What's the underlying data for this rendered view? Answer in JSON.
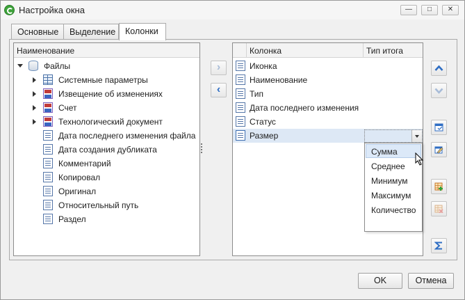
{
  "window": {
    "title": "Настройка окна",
    "controls": {
      "minimize": "—",
      "maximize": "□",
      "close": "✕"
    }
  },
  "tabs": [
    {
      "label": "Основные",
      "active": false
    },
    {
      "label": "Выделение",
      "active": false
    },
    {
      "label": "Колонки",
      "active": true
    }
  ],
  "available_fields": {
    "header": "Наименование",
    "items": [
      {
        "label": "Файлы",
        "icon": "database-icon",
        "expander": "expanded"
      },
      {
        "label": "Системные параметры",
        "icon": "table-icon",
        "expander": "collapsed"
      },
      {
        "label": "Извещение об изменениях",
        "icon": "reference-icon",
        "expander": "collapsed"
      },
      {
        "label": "Счет",
        "icon": "reference-icon",
        "expander": "collapsed"
      },
      {
        "label": "Технологический документ",
        "icon": "reference-icon",
        "expander": "collapsed"
      },
      {
        "label": "Дата последнего изменения файла",
        "icon": "field-icon"
      },
      {
        "label": "Дата создания дубликата",
        "icon": "field-icon"
      },
      {
        "label": "Комментарий",
        "icon": "field-icon"
      },
      {
        "label": "Копировал",
        "icon": "field-icon"
      },
      {
        "label": "Оригинал",
        "icon": "field-icon"
      },
      {
        "label": "Относительный путь",
        "icon": "field-icon"
      },
      {
        "label": "Раздел",
        "icon": "field-icon"
      }
    ]
  },
  "transfer_buttons": {
    "add": "›",
    "remove": "‹"
  },
  "selected_columns": {
    "headers": {
      "column": "Колонка",
      "total_type": "Тип итога"
    },
    "rows": [
      {
        "label": "Иконка",
        "icon": "field-icon",
        "total": ""
      },
      {
        "label": "Наименование",
        "icon": "field-icon",
        "total": ""
      },
      {
        "label": "Тип",
        "icon": "type-field-icon",
        "total": ""
      },
      {
        "label": "Дата последнего изменения",
        "icon": "date-field-icon",
        "total": ""
      },
      {
        "label": "Статус",
        "icon": "field-icon",
        "total": ""
      },
      {
        "label": "Размер",
        "icon": "field-icon",
        "total": "",
        "selected": true
      }
    ]
  },
  "total_dropdown": {
    "options": [
      "Сумма",
      "Среднее",
      "Минимум",
      "Максимум",
      "Количество"
    ],
    "hovered": "Сумма"
  },
  "side_toolbar": [
    {
      "name": "move-up-button",
      "icon": "arrow-up-icon",
      "enabled": true
    },
    {
      "name": "move-down-button",
      "icon": "arrow-down-icon",
      "enabled": false
    },
    {
      "name": "column-settings-button",
      "icon": "column-settings-icon",
      "enabled": true
    },
    {
      "name": "edit-column-button",
      "icon": "edit-column-icon",
      "enabled": true
    },
    {
      "name": "add-table-column-button",
      "icon": "table-add-icon",
      "enabled": true
    },
    {
      "name": "remove-table-column-button",
      "icon": "table-remove-icon",
      "enabled": false
    },
    {
      "name": "totals-button",
      "icon": "sigma-icon",
      "enabled": true
    }
  ],
  "dialog_buttons": {
    "ok": "OK",
    "cancel": "Отмена"
  },
  "colors": {
    "accent_blue": "#2f6ec4",
    "selection": "#dde8f5",
    "hover": "#dce9f8"
  }
}
